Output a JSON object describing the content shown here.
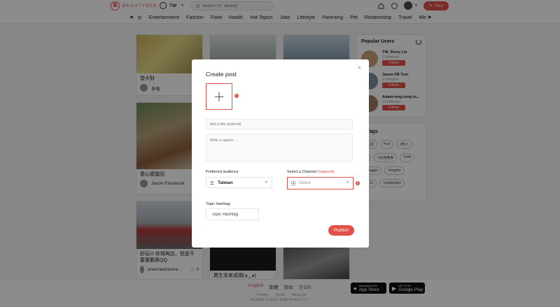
{
  "header": {
    "logo_text": "BEAUTYBEE",
    "region": "TW",
    "search_placeholder": "Search for \"Beauty\"",
    "post_label": "Post"
  },
  "categories": [
    "ty",
    "Entertainment",
    "Fashion",
    "Food",
    "Health",
    "Hot Topics",
    "Jobs",
    "Lifestyle",
    "Parenting",
    "Pet",
    "Relationship",
    "Travel",
    "We"
  ],
  "feed": {
    "cards": [
      {
        "caption": "發大財",
        "author": "多啦"
      },
      {
        "caption": "愛心便當回",
        "author": "Jason Facebook"
      },
      {
        "caption": "好玩!!! 你得再訪，但是不要重觀表QQ",
        "author": "oneoneoneone...",
        "likes": "0"
      },
      {
        "caption": "貫生本來成燒(◕‿◕)",
        "author": ""
      }
    ]
  },
  "sidebar": {
    "popular_title": "Popular Users",
    "users": [
      {
        "name": "TW_Perry Lin",
        "followers": "2 followers",
        "follow": "Follow"
      },
      {
        "name": "Jason FB Test",
        "followers": "2 followers",
        "follow": "Follow"
      },
      {
        "name": "Adam-long-long-lo...",
        "followers": "14 followers",
        "follow": "Follow"
      }
    ],
    "tags_title": "Tags",
    "tags": [
      "#生活",
      "#cat",
      "#吃人",
      "#r",
      "#台灣美食",
      "#345",
      "#blogger",
      "#negrito",
      "#7-11",
      "#celebrities"
    ]
  },
  "footer": {
    "langs": [
      "English",
      "繁體",
      "簡体",
      "한국어"
    ],
    "links": [
      "Privacy",
      "Terms",
      "About Us"
    ],
    "copyright": "Pricedigit © 2019 • Build Version 1.0.1",
    "appstore_small": "Download on the",
    "appstore_big": "App Store",
    "play_small": "GET IT ON",
    "play_big": "Google Play"
  },
  "modal": {
    "title": "Create post",
    "close": "×",
    "upload_plus": "+",
    "title_placeholder": "Add a title (optional)",
    "caption_placeholder": "Write a caption...",
    "audience_label": "Preferred audience",
    "audience_value": "Taiwan",
    "channel_label": "Select a Channel",
    "channel_required": "(required)",
    "channel_placeholder": "Select",
    "hashtag_label": "Topic Hashtag",
    "hashtag_value": "Topic Hashtag",
    "publish_label": "Publish",
    "error_mark": "!"
  },
  "colors": {
    "accent": "#e0514b",
    "overlay": "rgba(0,0,0,0.45)"
  }
}
